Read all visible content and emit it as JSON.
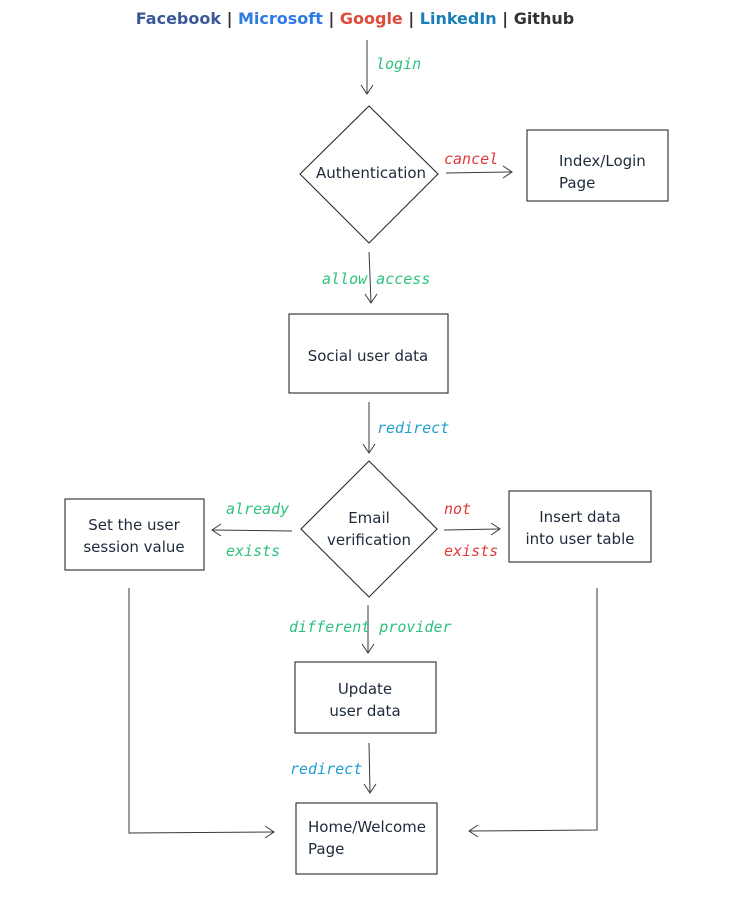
{
  "header": {
    "providers": [
      {
        "label": "Facebook",
        "color": "#3b5998"
      },
      {
        "label": "Microsoft",
        "color": "#2f7be6"
      },
      {
        "label": "Google",
        "color": "#e04a3a"
      },
      {
        "label": "LinkedIn",
        "color": "#1a7fb8"
      },
      {
        "label": "Github",
        "color": "#333333"
      }
    ],
    "separator": " | ",
    "separator_color": "#333333"
  },
  "colors": {
    "green": "#2ec27e",
    "red": "#e03b3b",
    "blue": "#1f9ed1"
  },
  "nodes": {
    "authentication": {
      "lines": [
        "Authentication"
      ],
      "shape": "diamond"
    },
    "index_login": {
      "lines": [
        "Index/Login",
        "Page"
      ],
      "shape": "rect"
    },
    "social_user_data": {
      "lines": [
        "Social user data"
      ],
      "shape": "rect"
    },
    "email_verification": {
      "lines": [
        "Email",
        "verification"
      ],
      "shape": "diamond"
    },
    "set_session": {
      "lines": [
        "Set the user",
        "session value"
      ],
      "shape": "rect"
    },
    "insert_data": {
      "lines": [
        "Insert data",
        "into user table"
      ],
      "shape": "rect"
    },
    "update_data": {
      "lines": [
        "Update",
        "user data"
      ],
      "shape": "rect"
    },
    "home_welcome": {
      "lines": [
        "Home/Welcome",
        "Page"
      ],
      "shape": "rect"
    }
  },
  "edges": [
    {
      "from": "providers",
      "to": "authentication",
      "label": [
        "login"
      ],
      "color": "green"
    },
    {
      "from": "authentication",
      "to": "index_login",
      "label": [
        "cancel"
      ],
      "color": "red"
    },
    {
      "from": "authentication",
      "to": "social_user_data",
      "label": [
        "allow access"
      ],
      "color": "green"
    },
    {
      "from": "social_user_data",
      "to": "email_verification",
      "label": [
        "redirect"
      ],
      "color": "blue"
    },
    {
      "from": "email_verification",
      "to": "set_session",
      "label": [
        "already",
        "exists"
      ],
      "color": "green"
    },
    {
      "from": "email_verification",
      "to": "insert_data",
      "label": [
        "not",
        "exists"
      ],
      "color": "red"
    },
    {
      "from": "email_verification",
      "to": "update_data",
      "label": [
        "different provider"
      ],
      "color": "green"
    },
    {
      "from": "update_data",
      "to": "home_welcome",
      "label": [
        "redirect"
      ],
      "color": "blue"
    },
    {
      "from": "set_session",
      "to": "home_welcome",
      "label": []
    },
    {
      "from": "insert_data",
      "to": "home_welcome",
      "label": []
    }
  ]
}
